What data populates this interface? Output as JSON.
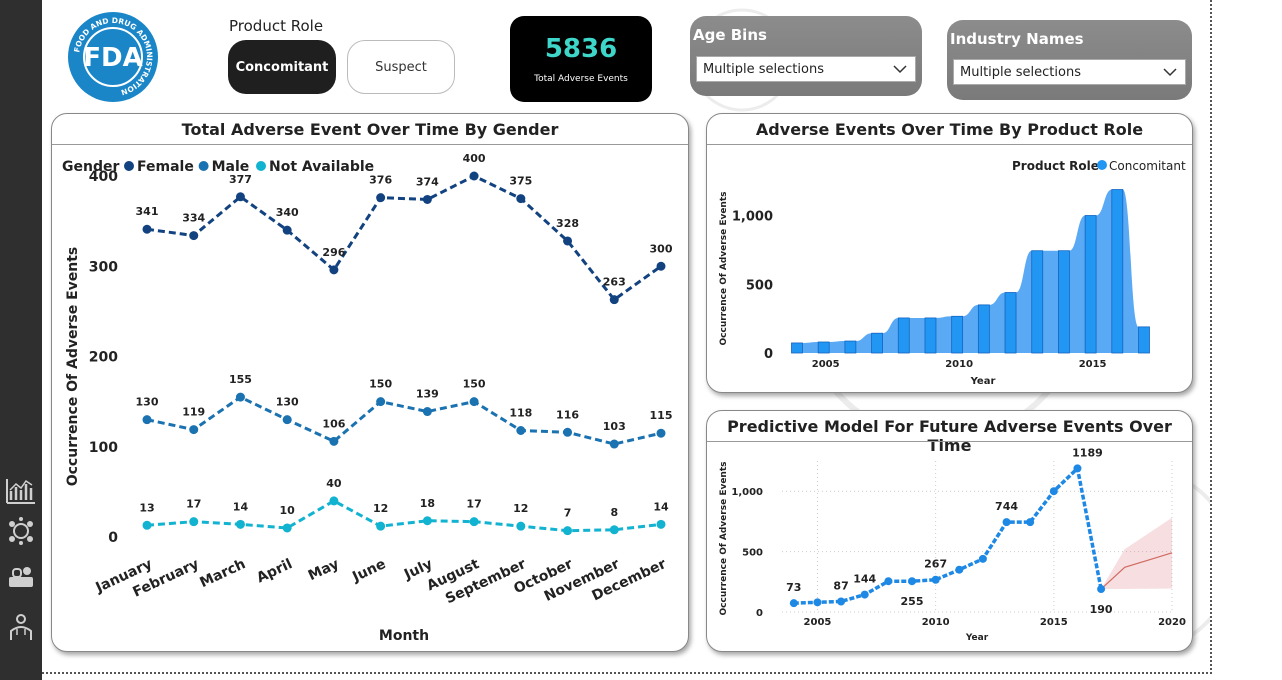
{
  "product_role": {
    "label": "Product Role",
    "options": [
      "Concomitant",
      "Suspect"
    ],
    "selected": "Concomitant"
  },
  "kpi": {
    "value": "5836",
    "label": "Total Adverse Events"
  },
  "slicers": [
    {
      "title": "Age Bins",
      "value": "Multiple selections"
    },
    {
      "title": "Industry Names",
      "value": "Multiple selections"
    }
  ],
  "logo": {
    "text": "FDA",
    "ring_text": "FOOD AND DRUG ADMINISTRATION",
    "color": "#1a86c8"
  },
  "sidebar_icons": [
    "line-chart-icon",
    "virus-icon",
    "medicine-icon",
    "doctor-icon"
  ],
  "chart_data": [
    {
      "type": "line",
      "title": "Total Adverse Event Over Time By Gender",
      "legend_title": "Gender",
      "categories": [
        "January",
        "February",
        "March",
        "April",
        "May",
        "June",
        "July",
        "August",
        "September",
        "October",
        "November",
        "December"
      ],
      "series": [
        {
          "name": "Female",
          "color": "#12427f",
          "values": [
            341,
            334,
            377,
            340,
            296,
            376,
            374,
            400,
            375,
            328,
            263,
            300
          ]
        },
        {
          "name": "Male",
          "color": "#1b72b0",
          "values": [
            130,
            119,
            155,
            130,
            106,
            150,
            139,
            150,
            118,
            116,
            103,
            115
          ]
        },
        {
          "name": "Not Available",
          "color": "#12b3d1",
          "values": [
            13,
            17,
            14,
            10,
            40,
            12,
            18,
            17,
            12,
            7,
            8,
            14
          ]
        }
      ],
      "xlabel": "Month",
      "ylabel": "Occurrence Of Adverse Events",
      "ylim": [
        0,
        400
      ],
      "yticks": [
        0,
        100,
        200,
        300,
        400
      ]
    },
    {
      "type": "bar",
      "title": "Adverse Events Over Time By Product Role",
      "legend_title": "Product Role",
      "series": [
        {
          "name": "Concomitant",
          "color": "#2196f3"
        }
      ],
      "x": [
        2004,
        2005,
        2006,
        2007,
        2008,
        2009,
        2010,
        2011,
        2012,
        2013,
        2014,
        2015,
        2016,
        2017
      ],
      "values": [
        73,
        80,
        87,
        144,
        255,
        255,
        267,
        350,
        440,
        744,
        744,
        1000,
        1189,
        190
      ],
      "xlabel": "Year",
      "ylabel": "Occurrence Of Adverse Events",
      "xticks": [
        2005,
        2010,
        2015
      ],
      "yticks": [
        0,
        500,
        1000
      ],
      "ytick_labels": [
        "0",
        "500",
        "1,000"
      ],
      "ylim": [
        0,
        1200
      ]
    },
    {
      "type": "line",
      "title": "Predictive Model For Future Adverse Events Over Time",
      "x": [
        2004,
        2005,
        2006,
        2007,
        2008,
        2009,
        2010,
        2011,
        2012,
        2013,
        2014,
        2015,
        2016,
        2017
      ],
      "values": [
        73,
        80,
        87,
        144,
        255,
        255,
        267,
        350,
        440,
        744,
        744,
        1000,
        1189,
        190
      ],
      "point_labels": {
        "2004": "73",
        "2006": "87",
        "2007": "144",
        "2009": "255",
        "2010": "267",
        "2013": "744",
        "2016": "1189",
        "2017": "190"
      },
      "forecast": {
        "x": [
          2017,
          2018,
          2020
        ],
        "values": [
          190,
          370,
          490
        ],
        "upper": [
          190,
          520,
          780
        ],
        "lower": [
          190,
          190,
          195
        ],
        "color": "#c0392b"
      },
      "xlabel": "Year",
      "ylabel": "Occurrence Of Adverse Events",
      "xticks": [
        2005,
        2010,
        2015,
        2020
      ],
      "yticks": [
        0,
        500,
        1000
      ],
      "ytick_labels": [
        "0",
        "500",
        "1,000"
      ],
      "xlim": [
        2003.5,
        2020
      ],
      "ylim": [
        0,
        1250
      ]
    }
  ]
}
